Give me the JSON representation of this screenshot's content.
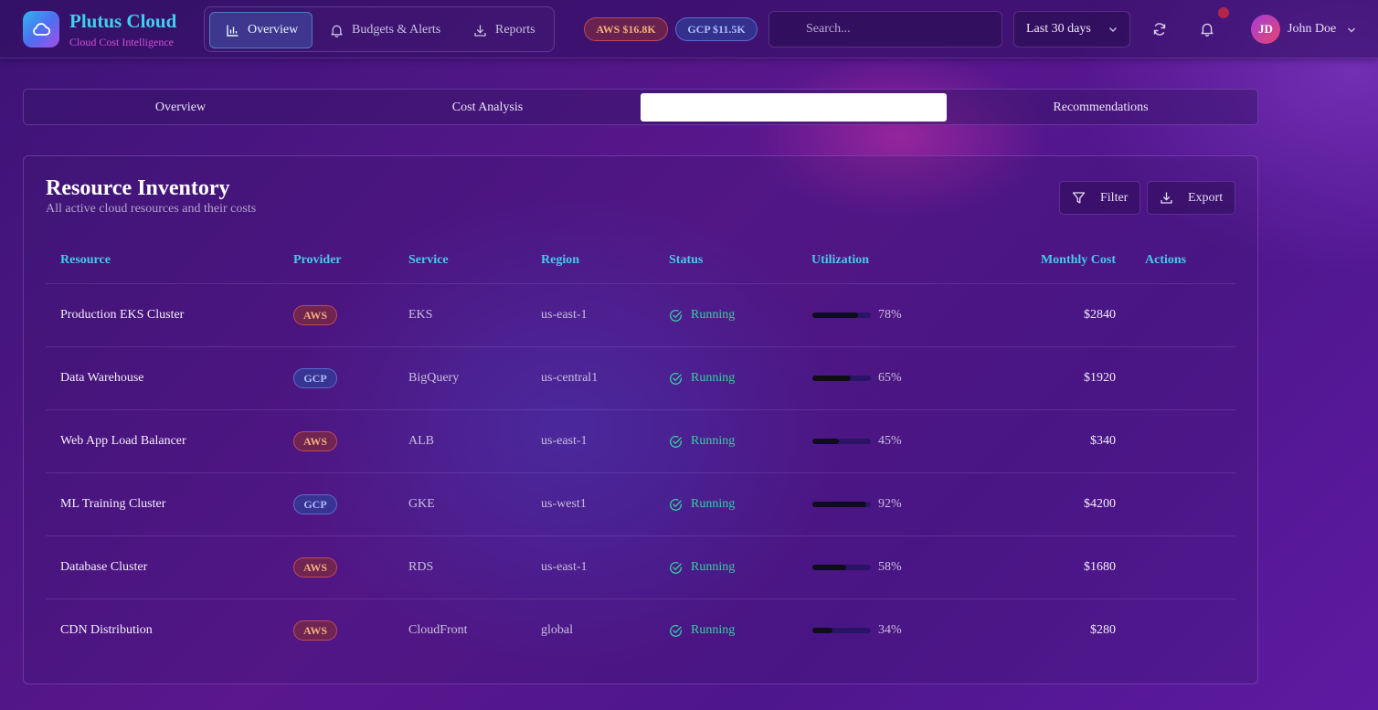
{
  "app": {
    "name": "Plutus Cloud",
    "tagline": "Cloud Cost Intelligence"
  },
  "nav": {
    "items": [
      {
        "label": "Overview",
        "icon": "bar-chart-icon",
        "active": true
      },
      {
        "label": "Budgets & Alerts",
        "icon": "bell-icon",
        "active": false
      },
      {
        "label": "Reports",
        "icon": "download-icon",
        "active": false
      }
    ]
  },
  "spend_pills": {
    "aws": "AWS $16.8K",
    "gcp": "GCP $11.5K"
  },
  "search": {
    "placeholder": "Search...",
    "value": ""
  },
  "date_range": {
    "selected": "Last 30 days"
  },
  "header_icons": [
    "refresh-icon",
    "bell-icon"
  ],
  "user": {
    "initials": "JD",
    "name": "John Doe"
  },
  "tabs": [
    {
      "label": "Overview",
      "active": false
    },
    {
      "label": "Cost Analysis",
      "active": false
    },
    {
      "label": "",
      "active": true
    },
    {
      "label": "Recommendations",
      "active": false
    }
  ],
  "card": {
    "title": "Resource Inventory",
    "subtitle": "All active cloud resources and their costs",
    "filter_label": "Filter",
    "export_label": "Export"
  },
  "table": {
    "columns": [
      "Resource",
      "Provider",
      "Service",
      "Region",
      "Status",
      "Utilization",
      "Monthly Cost",
      "Actions"
    ],
    "rows": [
      {
        "resource": "Production EKS Cluster",
        "provider": "AWS",
        "service": "EKS",
        "region": "us-east-1",
        "status": "Running",
        "utilization": "78%",
        "util_value": 0.78,
        "cost": "$2840"
      },
      {
        "resource": "Data Warehouse",
        "provider": "GCP",
        "service": "BigQuery",
        "region": "us-central1",
        "status": "Running",
        "utilization": "65%",
        "util_value": 0.65,
        "cost": "$1920"
      },
      {
        "resource": "Web App Load Balancer",
        "provider": "AWS",
        "service": "ALB",
        "region": "us-east-1",
        "status": "Running",
        "utilization": "45%",
        "util_value": 0.45,
        "cost": "$340"
      },
      {
        "resource": "ML Training Cluster",
        "provider": "GCP",
        "service": "GKE",
        "region": "us-west1",
        "status": "Running",
        "utilization": "92%",
        "util_value": 0.92,
        "cost": "$4200"
      },
      {
        "resource": "Database Cluster",
        "provider": "AWS",
        "service": "RDS",
        "region": "us-east-1",
        "status": "Running",
        "utilization": "58%",
        "util_value": 0.58,
        "cost": "$1680"
      },
      {
        "resource": "CDN Distribution",
        "provider": "AWS",
        "service": "CloudFront",
        "region": "global",
        "status": "Running",
        "utilization": "34%",
        "util_value": 0.34,
        "cost": "$280"
      }
    ]
  },
  "colors": {
    "accent": "#3fd0f0",
    "status_running": "#34d0a0",
    "aws_badge": "#f3b07a",
    "gcp_badge": "#aebcff"
  }
}
